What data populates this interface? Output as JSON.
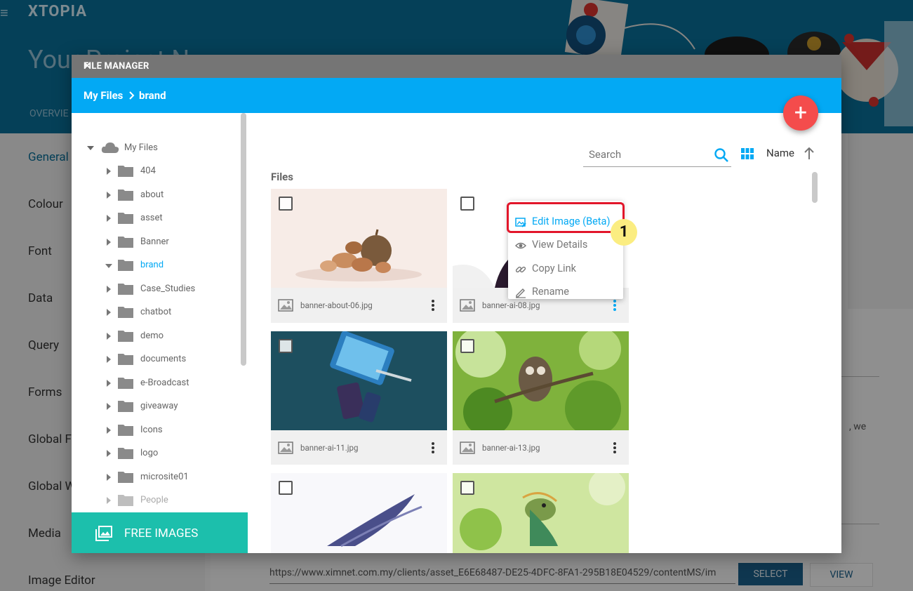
{
  "app": {
    "logo": "XTOPIA",
    "project_title": "Your Project N",
    "tab_overview": "OVERVIE",
    "menu_icon": "hamburger-icon"
  },
  "sidebar": {
    "items": [
      {
        "label": "General"
      },
      {
        "label": "Colour"
      },
      {
        "label": "Font"
      },
      {
        "label": "Data"
      },
      {
        "label": "Query"
      },
      {
        "label": "Forms"
      },
      {
        "label": "Global F"
      },
      {
        "label": "Global W"
      },
      {
        "label": "Media"
      },
      {
        "label": "Image Editor"
      }
    ]
  },
  "background_page": {
    "url_value": "https://www.ximnet.com.my/clients/asset_E6E68487-DE25-4DFC-8FA1-295B18E04529/contentMS/im",
    "select_label": "SELECT",
    "view_label": "VIEW",
    "partial_text": ", we"
  },
  "modal": {
    "title": "FILE MANAGER",
    "breadcrumb": [
      "My Files",
      "brand"
    ],
    "add_label": "+",
    "free_images_label": "FREE IMAGES",
    "tree_root": "My Files",
    "tree": [
      {
        "label": "404",
        "expanded": false
      },
      {
        "label": "about",
        "expanded": false
      },
      {
        "label": "asset",
        "expanded": false
      },
      {
        "label": "Banner",
        "expanded": false
      },
      {
        "label": "brand",
        "expanded": true,
        "active": true
      },
      {
        "label": "Case_Studies",
        "expanded": false
      },
      {
        "label": "chatbot",
        "expanded": false
      },
      {
        "label": "demo",
        "expanded": false
      },
      {
        "label": "documents",
        "expanded": false
      },
      {
        "label": "e-Broadcast",
        "expanded": false
      },
      {
        "label": "giveaway",
        "expanded": false
      },
      {
        "label": "Icons",
        "expanded": false
      },
      {
        "label": "logo",
        "expanded": false
      },
      {
        "label": "microsite01",
        "expanded": false
      },
      {
        "label": "People",
        "expanded": false
      }
    ],
    "search_placeholder": "Search",
    "sort_label": "Name",
    "files_heading": "Files",
    "files": [
      {
        "name": "banner-about-06.jpg"
      },
      {
        "name": "banner-ai-08.jpg"
      },
      {
        "name": "banner-ai-11.jpg"
      },
      {
        "name": "banner-ai-13.jpg"
      },
      {
        "name": ""
      },
      {
        "name": ""
      }
    ],
    "context_menu": [
      {
        "label": "Edit Image (Beta)",
        "icon": "edit-image-icon",
        "highlighted": true
      },
      {
        "label": "View Details",
        "icon": "eye-icon"
      },
      {
        "label": "Copy Link",
        "icon": "link-icon"
      },
      {
        "label": "Rename",
        "icon": "pencil-icon"
      }
    ],
    "step_badge": "1"
  },
  "colors": {
    "accent": "#03a9f4",
    "title_bar": "#757575",
    "fab": "#f44c4c",
    "free_images": "#1cbfac",
    "highlight": "#e2162a",
    "badge": "#fbed81"
  }
}
